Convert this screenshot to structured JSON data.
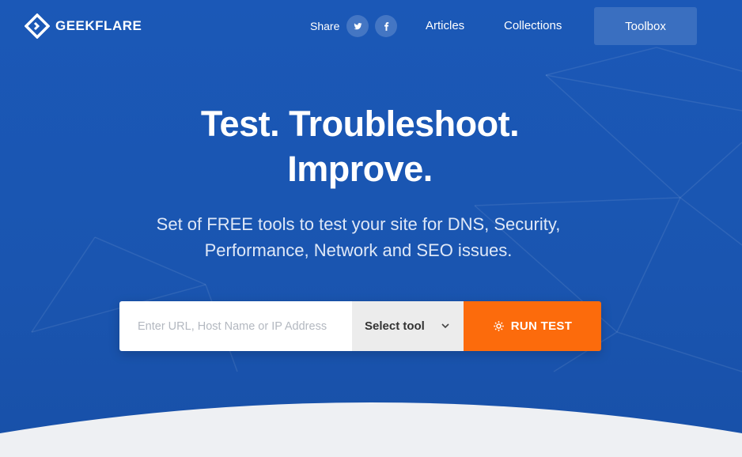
{
  "brand": {
    "name": "GEEKFLARE"
  },
  "nav": {
    "share_label": "Share",
    "social": [
      {
        "name": "twitter",
        "icon": "twitter-icon"
      },
      {
        "name": "facebook",
        "icon": "facebook-icon"
      }
    ],
    "articles": "Articles",
    "collections": "Collections",
    "toolbox": "Toolbox"
  },
  "hero": {
    "headline_line1": "Test. Troubleshoot.",
    "headline_line2": "Improve.",
    "subtitle_line1": "Set of FREE tools to test your site for DNS, Security,",
    "subtitle_line2": "Performance, Network and SEO issues."
  },
  "search": {
    "placeholder": "Enter URL, Host Name or IP Address",
    "value": "",
    "select_label": "Select tool",
    "run_label": "RUN TEST"
  },
  "colors": {
    "background": "#1a57b5",
    "toolbox_button": "#3a6fc0",
    "run_button": "#fc6b0c",
    "select_bg": "#ececec"
  }
}
